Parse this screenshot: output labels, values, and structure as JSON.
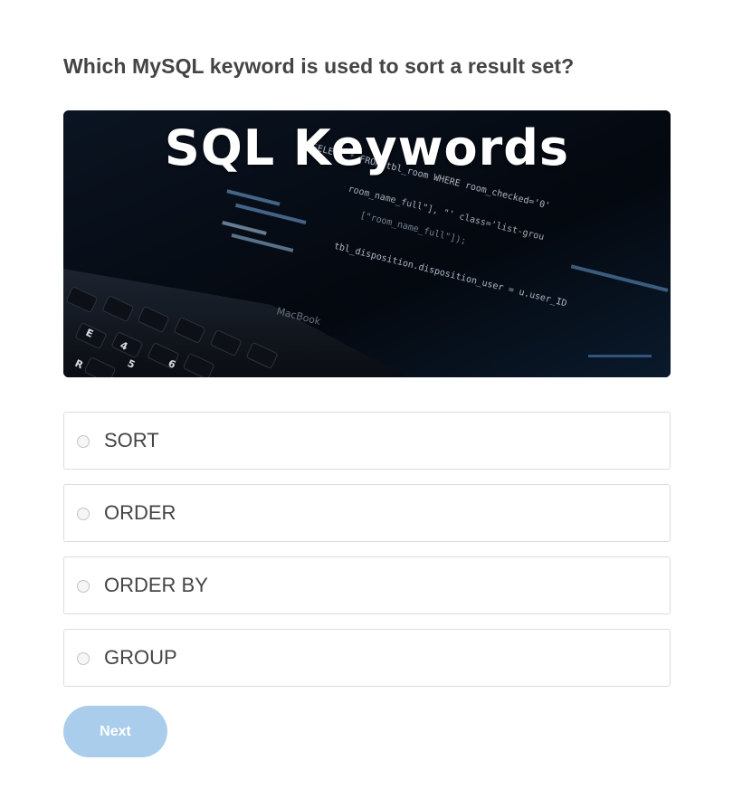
{
  "question": "Which MySQL keyword is used to sort a result set?",
  "hero": {
    "title": "SQL Keywords",
    "code_lines": [
      "SELECT * FROM tbl_room WHERE room_checked='0'",
      "room_name_full\"], \"' class='list-grou",
      "[\"room_name_full\"]);",
      "tbl_disposition.disposition_user = u.user_ID"
    ],
    "laptop_brand": "MacBook",
    "key_labels": [
      "4",
      "5",
      "6",
      "E",
      "R"
    ]
  },
  "options": [
    {
      "label": "SORT"
    },
    {
      "label": "ORDER"
    },
    {
      "label": "ORDER BY"
    },
    {
      "label": "GROUP"
    }
  ],
  "next_label": "Next",
  "colors": {
    "button": "#a9cdea",
    "border": "#dcdcdc",
    "text": "#444444"
  }
}
